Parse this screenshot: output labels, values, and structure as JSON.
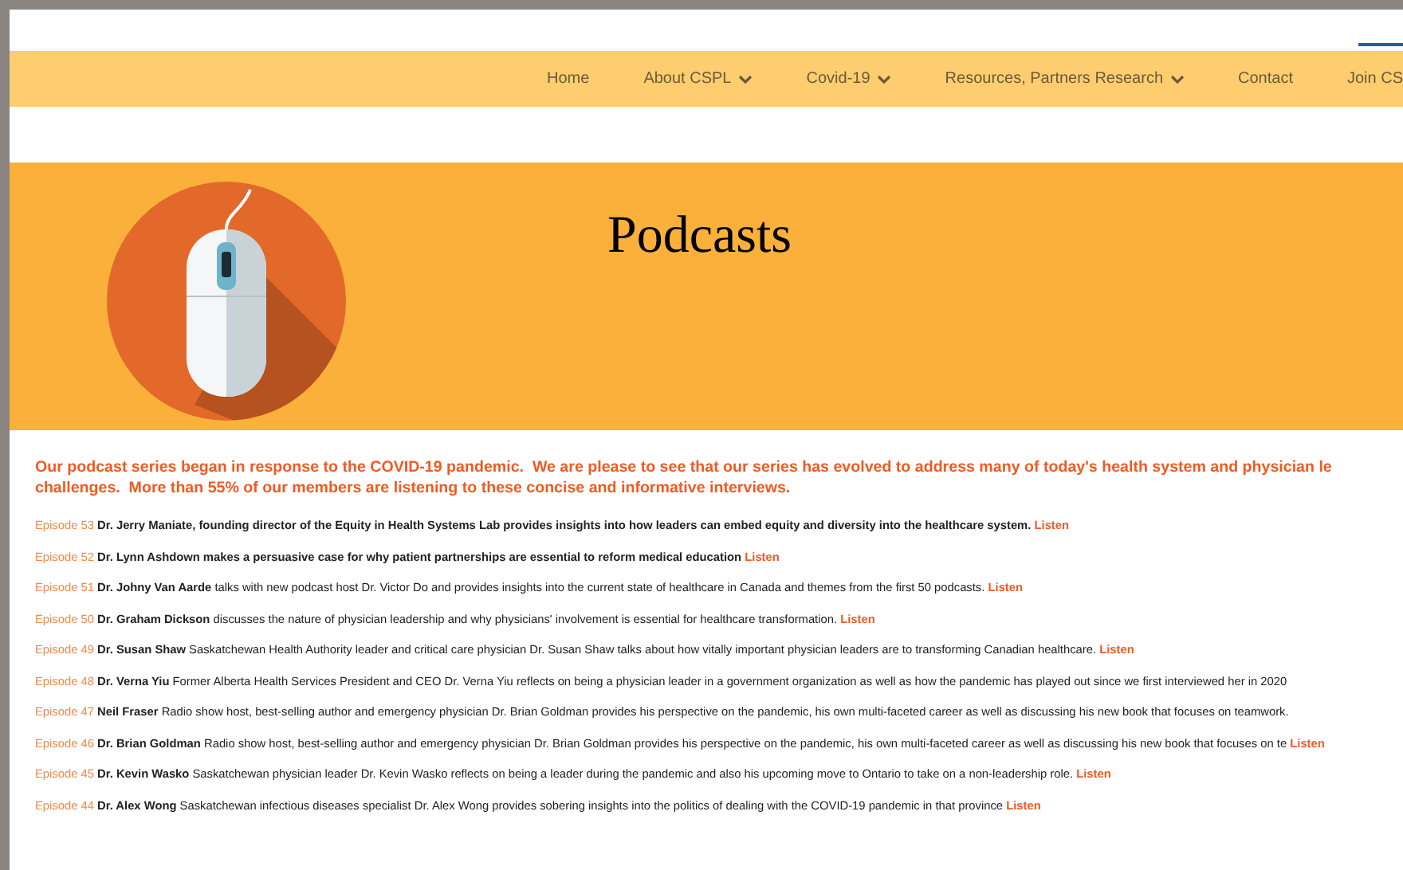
{
  "nav": [
    {
      "label": "Home",
      "dropdown": false
    },
    {
      "label": "About CSPL",
      "dropdown": true
    },
    {
      "label": "Covid-19",
      "dropdown": true
    },
    {
      "label": "Resources, Partners Research",
      "dropdown": true
    },
    {
      "label": "Contact",
      "dropdown": false
    },
    {
      "label": "Join CS",
      "dropdown": false
    }
  ],
  "banner": {
    "title": "Podcasts"
  },
  "intro": [
    "Our podcast series began in response to the COVID-19 pandemic.  We are please to see that our series has evolved to address many of today's health system and physician le",
    "challenges.  More than 55% of our members are listening to these concise and informative interviews."
  ],
  "episodes": [
    {
      "episode": "Episode 53",
      "bold": true,
      "text": "Dr. Jerry Maniate, founding director of the Equity in Health Systems Lab provides insights into how leaders can embed equity and diversity into the healthcare system.",
      "listen": "Listen"
    },
    {
      "episode": "Episode 52",
      "bold": true,
      "text": "Dr. Lynn Ashdown makes a persuasive case for why patient partnerships are essential to reform medical education",
      "listen": "Listen"
    },
    {
      "episode": "Episode 51",
      "bold": false,
      "text": "**Dr. Johny Van Aarde** talks with new podcast host Dr. Victor Do and provides insights into the current state of healthcare in Canada and themes from the first 50 podcasts.",
      "listen": "Listen"
    },
    {
      "episode": "Episode 50",
      "bold": false,
      "text": "**Dr. Graham Dickson** discusses the nature of physician leadership and why physicians' involvement is essential for healthcare transformation.",
      "listen": "Listen"
    },
    {
      "episode": "Episode 49",
      "bold": false,
      "text": "**Dr. Susan Shaw** Saskatchewan Health Authority leader and critical care physician Dr. Susan Shaw talks about how vitally important physician leaders are to transforming Canadian healthcare.",
      "listen": "Listen"
    },
    {
      "episode": "Episode 48",
      "bold": false,
      "text": "**Dr. Verna Yiu** Former Alberta Health Services President and CEO Dr. Verna Yiu reflects on being a physician leader in a government organization as well as how the pandemic has played out since we first interviewed her in 2020"
    },
    {
      "episode": "Episode 47",
      "bold": false,
      "text": "**Neil Fraser** Radio show host, best-selling author and emergency physician Dr. Brian Goldman provides his perspective on the pandemic, his own multi-faceted career as well as discussing his new book that focuses on teamwork."
    },
    {
      "episode": "Episode 46",
      "bold": false,
      "text": "**Dr. Brian Goldman** Radio show host, best-selling author and emergency physician Dr. Brian Goldman provides his perspective on the pandemic, his own multi-faceted career as well as discussing his new book that focuses on te",
      "listen": "Listen"
    },
    {
      "episode": "Episode 45",
      "bold": false,
      "text": "**Dr. Kevin Wasko** Saskatchewan physician leader Dr. Kevin Wasko reflects on being a leader during the pandemic and also his upcoming move to Ontario to take on a non-leadership role.",
      "listen": "Listen"
    },
    {
      "episode": "Episode 44",
      "bold": false,
      "text": "**Dr. Alex Wong** Saskatchewan infectious diseases specialist Dr. Alex Wong provides sobering insights into the politics of dealing with the COVID-19 pandemic in that province",
      "listen": "Listen"
    }
  ]
}
